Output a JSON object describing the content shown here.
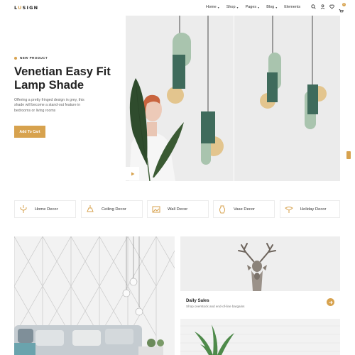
{
  "header": {
    "logo_prefix": "L",
    "logo_accent": "U",
    "logo_rest": "SIGN",
    "nav": [
      {
        "label": "Home",
        "has_dropdown": true
      },
      {
        "label": "Shop",
        "has_dropdown": true
      },
      {
        "label": "Pages",
        "has_dropdown": true
      },
      {
        "label": "Blog",
        "has_dropdown": true
      },
      {
        "label": "Elements",
        "has_dropdown": false
      }
    ],
    "icons": [
      "search-icon",
      "user-icon",
      "heart-icon",
      "cart-icon"
    ],
    "cart_count": "0"
  },
  "hero": {
    "badge": "NEW PRODUCT",
    "title": "Venetian Easy Fit Lamp Shade",
    "description": "Offering a pretty fringed design in grey, this shade will become a stand-out feature in bedrooms or living rooms",
    "cta": "Add To Cart"
  },
  "categories": [
    {
      "label": "Home Decor",
      "icon": "chandelier-icon"
    },
    {
      "label": "Ceiling Decor",
      "icon": "ceiling-lamp-icon"
    },
    {
      "label": "Wall Decor",
      "icon": "wall-frame-icon"
    },
    {
      "label": "Vase Decor",
      "icon": "vase-icon"
    },
    {
      "label": "Holiday Decor",
      "icon": "ornament-icon"
    }
  ],
  "promo": {
    "title": "Daily Sales",
    "subtitle": "Shop overstock and end-of-line bargains"
  },
  "colors": {
    "accent": "#d7a24e",
    "lamp_green": "#3f6b5c",
    "lamp_light_green": "#a9c4ae",
    "lamp_gold": "#e3c58e"
  }
}
